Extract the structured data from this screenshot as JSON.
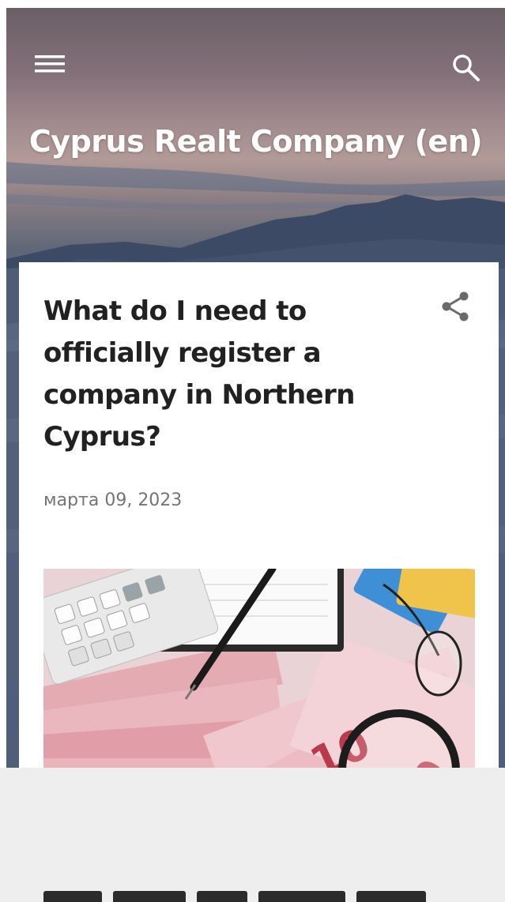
{
  "header": {
    "blog_title": "Cyprus Realt Company (en)",
    "menu_icon": "menu-icon",
    "search_icon": "search-icon",
    "text_color": "#ffffff"
  },
  "post": {
    "title": "What do I need to officially register a company in Northern Cyprus?",
    "date": "марта 09, 2023",
    "share_icon": "share-icon",
    "image_subject": "turkish-lira-banknotes-calculator-pen-magnifier",
    "title_color": "#212121",
    "date_color": "#757575"
  }
}
